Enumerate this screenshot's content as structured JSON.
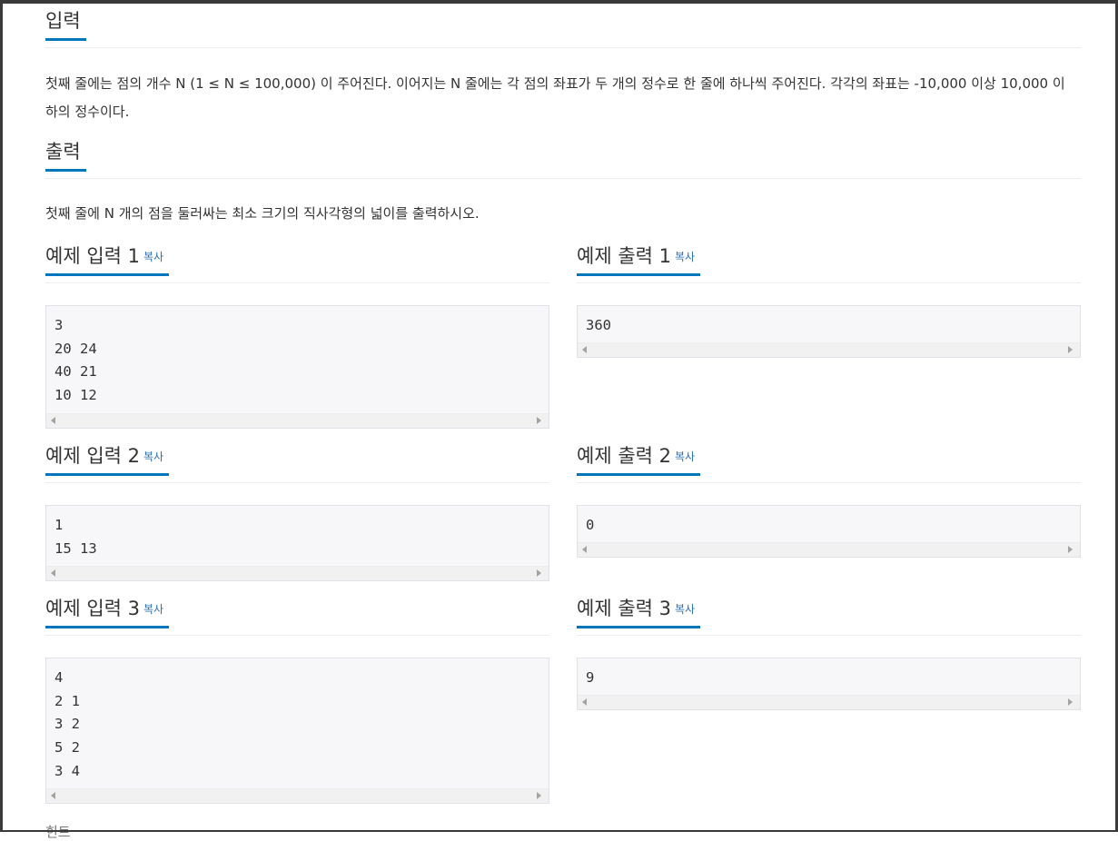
{
  "input_section": {
    "title": "입력",
    "text": "첫째 줄에는 점의 개수 N (1 ≤ N ≤ 100,000) 이 주어진다. 이어지는 N 줄에는 각 점의 좌표가 두 개의 정수로 한 줄에 하나씩 주어진다. 각각의 좌표는 -10,000 이상 10,000 이하의 정수이다."
  },
  "output_section": {
    "title": "출력",
    "text": "첫째 줄에 N 개의 점을 둘러싸는 최소 크기의 직사각형의 넓이를 출력하시오."
  },
  "copy_label": "복사",
  "samples": [
    {
      "input_title": "예제 입력 1",
      "input": "3\n20 24\n40 21\n10 12",
      "output_title": "예제 출력 1",
      "output": "360"
    },
    {
      "input_title": "예제 입력 2",
      "input": "1\n15 13",
      "output_title": "예제 출력 2",
      "output": "0"
    },
    {
      "input_title": "예제 입력 3",
      "input": "4\n2 1\n3 2\n5 2\n3 4",
      "output_title": "예제 출력 3",
      "output": "9"
    }
  ],
  "next_section_cutoff": "힌트"
}
